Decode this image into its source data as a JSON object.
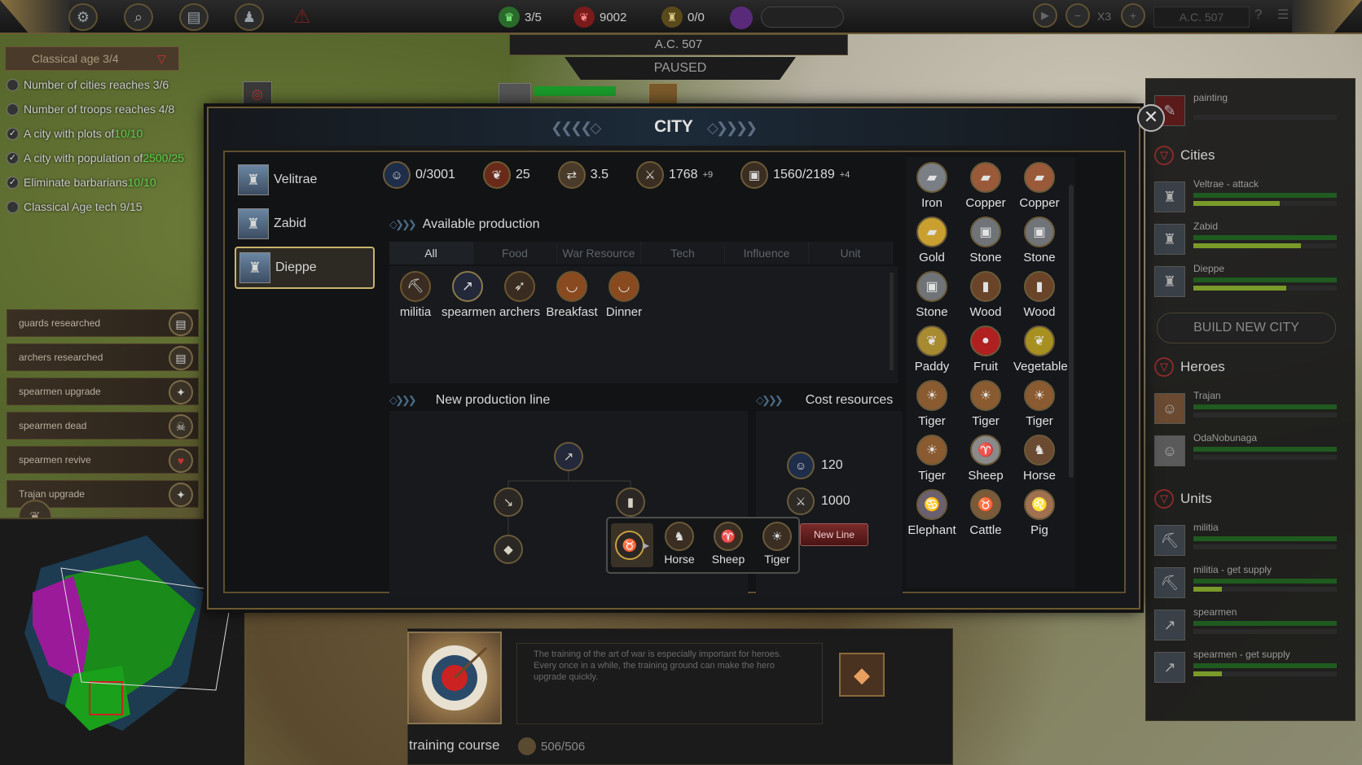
{
  "topbar": {
    "troops": "3/5",
    "food": "9002",
    "buildings": "0/0",
    "speed": "X3",
    "date": "A.C. 507"
  },
  "date_bar": "A.C. 507",
  "paused": "PAUSED",
  "quests": {
    "age": "Classical age 3/4",
    "items": [
      {
        "text": "Number of cities reaches 3/6",
        "done": false
      },
      {
        "text": "Number of troops reaches 4/8",
        "done": false
      },
      {
        "text": "A city with plots of ",
        "value": "10/10",
        "done": true
      },
      {
        "text": "A city with population of ",
        "value": "2500/25",
        "done": true
      },
      {
        "text": "Eliminate barbarians ",
        "value": "10/10",
        "done": true
      },
      {
        "text": "Classical Age tech 9/15",
        "done": false
      }
    ]
  },
  "notifications": [
    {
      "text": "guards researched"
    },
    {
      "text": "archers researched"
    },
    {
      "text": "spearmen upgrade"
    },
    {
      "text": "spearmen dead"
    },
    {
      "text": "spearmen revive"
    },
    {
      "text": "Trajan upgrade"
    }
  ],
  "right_panel": {
    "top_item": "painting",
    "cities_title": "Cities",
    "cities": [
      {
        "name": "Veltrae - attack",
        "progress": 0.6
      },
      {
        "name": "Zabid",
        "progress": 0.75
      },
      {
        "name": "Dieppe",
        "progress": 0.65
      }
    ],
    "build_new_city": "BUILD NEW CITY",
    "heroes_title": "Heroes",
    "heroes": [
      {
        "name": "Trajan"
      },
      {
        "name": "OdaNobunaga"
      }
    ],
    "units_title": "Units",
    "units": [
      {
        "name": "militia",
        "progress": 0
      },
      {
        "name": "militia - get supply",
        "progress": 0.2
      },
      {
        "name": "spearmen",
        "progress": 0
      },
      {
        "name": "spearmen - get supply",
        "progress": 0.2
      }
    ]
  },
  "modal": {
    "title": "CITY",
    "cities": [
      {
        "name": "Velitrae"
      },
      {
        "name": "Zabid"
      },
      {
        "name": "Dieppe"
      }
    ],
    "selected_city": "Dieppe",
    "resources": [
      {
        "icon": "population-icon",
        "value": "0/3001",
        "bonus": ""
      },
      {
        "icon": "food-icon",
        "value": "25",
        "bonus": ""
      },
      {
        "icon": "trade-icon",
        "value": "3.5",
        "bonus": ""
      },
      {
        "icon": "war-resource-icon",
        "value": "1768",
        "bonus": "+9"
      },
      {
        "icon": "storage-icon",
        "value": "1560/2189",
        "bonus": "+4"
      }
    ],
    "available_production": "Available production",
    "tabs": [
      "All",
      "Food",
      "War Resource",
      "Tech",
      "Influence",
      "Unit"
    ],
    "active_tab": "All",
    "production": [
      {
        "name": "militia",
        "icon": "pickaxe-icon"
      },
      {
        "name": "spearmen",
        "icon": "spear-icon"
      },
      {
        "name": "archers",
        "icon": "bow-icon"
      },
      {
        "name": "Breakfast",
        "icon": "bowl-icon"
      },
      {
        "name": "Dinner",
        "icon": "bowl-icon"
      }
    ],
    "new_production_line": "New production line",
    "cost_resources": "Cost resources",
    "popup": [
      {
        "name": "Horse"
      },
      {
        "name": "Sheep"
      },
      {
        "name": "Tiger"
      }
    ],
    "costs": [
      {
        "icon": "population-icon",
        "value": "120"
      },
      {
        "icon": "war-resource-icon",
        "value": "1000"
      }
    ],
    "new_line": "New Line",
    "resource_grid": [
      {
        "name": "Iron",
        "color": "#7a7f86"
      },
      {
        "name": "Copper",
        "color": "#9a5a3a"
      },
      {
        "name": "Copper",
        "color": "#9a5a3a"
      },
      {
        "name": "Gold",
        "color": "#c9a030"
      },
      {
        "name": "Stone",
        "color": "#707478"
      },
      {
        "name": "Stone",
        "color": "#707478"
      },
      {
        "name": "Stone",
        "color": "#707478"
      },
      {
        "name": "Wood",
        "color": "#6a4428"
      },
      {
        "name": "Wood",
        "color": "#6a4428"
      },
      {
        "name": "Paddy",
        "color": "#a88a30"
      },
      {
        "name": "Fruit",
        "color": "#b02020"
      },
      {
        "name": "Vegetable",
        "color": "#a89020"
      },
      {
        "name": "Tiger",
        "color": "#8a5a30"
      },
      {
        "name": "Tiger",
        "color": "#8a5a30"
      },
      {
        "name": "Tiger",
        "color": "#8a5a30"
      },
      {
        "name": "Tiger",
        "color": "#8a5a30"
      },
      {
        "name": "Sheep",
        "color": "#8a8a8a"
      },
      {
        "name": "Horse",
        "color": "#6a4a30"
      },
      {
        "name": "Elephant",
        "color": "#6a6070"
      },
      {
        "name": "Cattle",
        "color": "#7a5a38"
      },
      {
        "name": "Pig",
        "color": "#a07050"
      }
    ]
  },
  "building": {
    "name": "training course",
    "cost": "506/506",
    "description": "The training of the art of war is especially important for heroes. Every once in a while, the training ground can make the hero upgrade quickly."
  }
}
